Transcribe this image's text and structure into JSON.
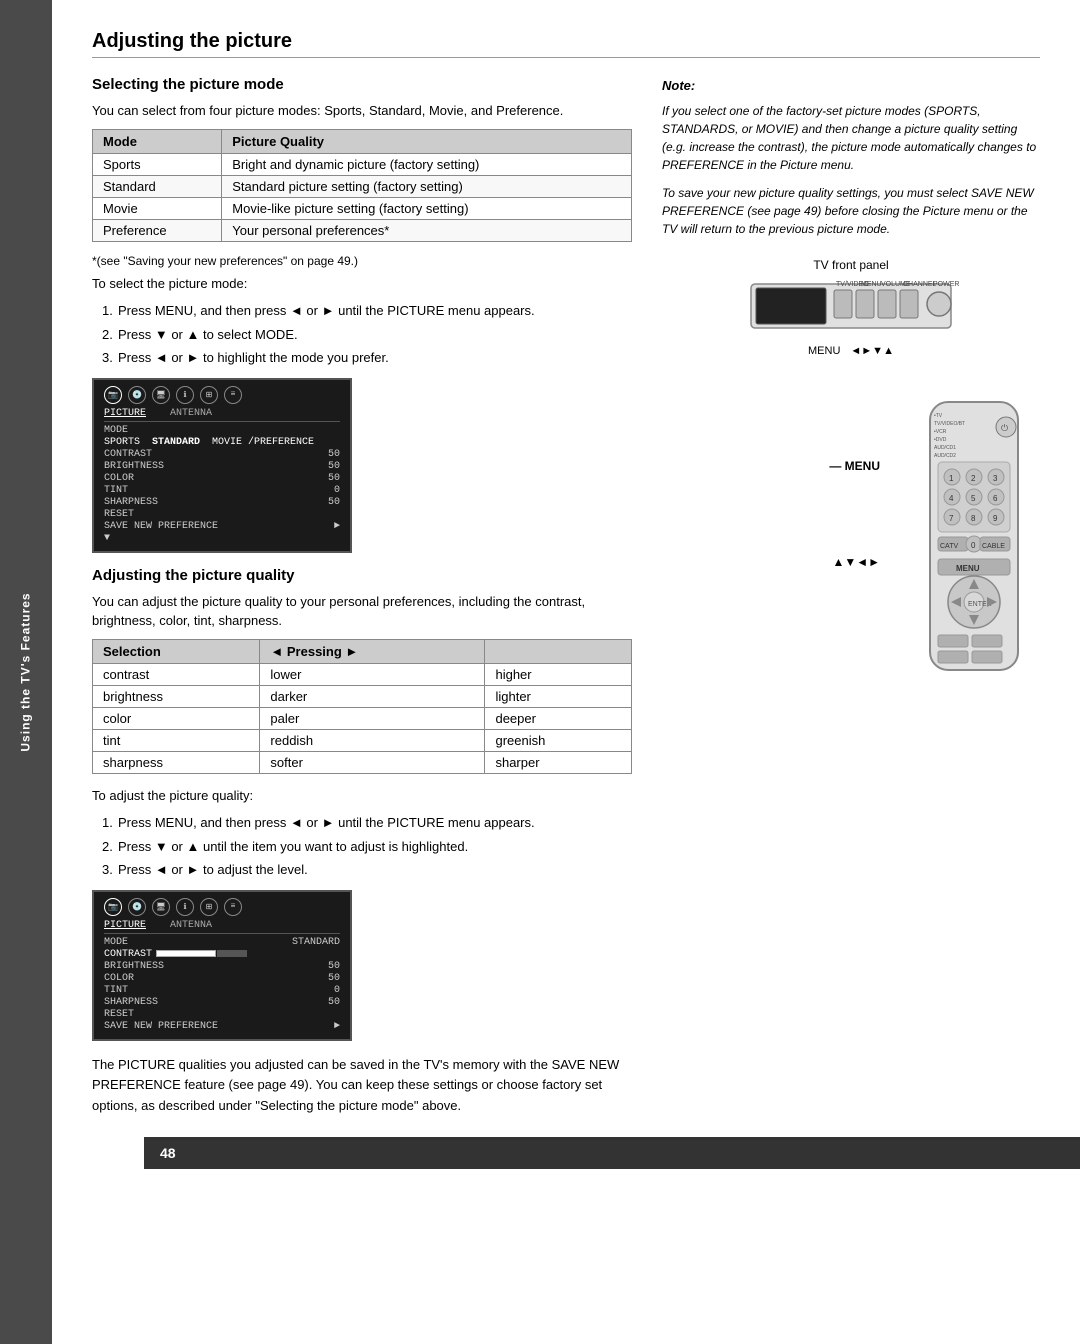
{
  "page": {
    "number": "48",
    "sidebar_text": "Using the TV's Features"
  },
  "main_heading": "Adjusting the picture",
  "selecting_section": {
    "heading": "Selecting the picture mode",
    "intro": "You can select from four picture modes: Sports, Standard, Movie, and Preference.",
    "table": {
      "col1": "Mode",
      "col2": "Picture Quality",
      "rows": [
        {
          "mode": "Sports",
          "quality": "Bright and dynamic picture (factory setting)"
        },
        {
          "mode": "Standard",
          "quality": "Standard picture setting (factory setting)"
        },
        {
          "mode": "Movie",
          "quality": "Movie-like picture setting (factory setting)"
        },
        {
          "mode": "Preference",
          "quality": "Your personal preferences*"
        }
      ]
    },
    "footnote": "*(see \"Saving your new preferences\" on page 49.)",
    "instructions_intro": "To select the picture mode:",
    "steps": [
      "Press MENU, and then press ◄ or ► until the PICTURE menu appears.",
      "Press ▼ or ▲ to select MODE.",
      "Press ◄ or ► to highlight the mode you prefer."
    ]
  },
  "quality_section": {
    "heading": "Adjusting the picture quality",
    "intro": "You can adjust the picture quality to your personal preferences, including the contrast, brightness, color, tint, sharpness.",
    "table": {
      "col1": "Selection",
      "col2": "◄ Pressing ►",
      "rows": [
        {
          "selection": "contrast",
          "left": "lower",
          "right": "higher"
        },
        {
          "selection": "brightness",
          "left": "darker",
          "right": "lighter"
        },
        {
          "selection": "color",
          "left": "paler",
          "right": "deeper"
        },
        {
          "selection": "tint",
          "left": "reddish",
          "right": "greenish"
        },
        {
          "selection": "sharpness",
          "left": "softer",
          "right": "sharper"
        }
      ]
    },
    "instructions_intro": "To adjust the picture quality:",
    "steps": [
      "Press MENU, and then press ◄ or ► until the PICTURE menu appears.",
      "Press ▼ or ▲ until the item you want to adjust is highlighted.",
      "Press ◄ or ► to adjust the level."
    ],
    "bottom_text": "The PICTURE qualities you adjusted can be saved in the TV's memory with the SAVE NEW PREFERENCE feature (see page 49). You can keep these settings or choose factory set options, as described under \"Selecting the picture mode\" above."
  },
  "note_section": {
    "title": "Note:",
    "paragraphs": [
      "If you select one of the factory-set picture modes (SPORTS, STANDARDS, or MOVIE) and then change a picture quality setting (e.g. increase the contrast), the picture mode automatically changes to PREFERENCE in the Picture menu.",
      "To save your new picture quality settings, you must select SAVE NEW PREFERENCE (see page 49) before closing the Picture menu or the TV will return to the previous picture mode."
    ]
  },
  "tv_panel": {
    "label": "TV front panel",
    "buttons": [
      "TV/VIDEO",
      "MENU",
      "VOLUME",
      "CHANNEL",
      "POWER"
    ],
    "menu_label": "MENU",
    "arrows_label": "◄►▼▲"
  },
  "screen1": {
    "icons": [
      "cam",
      "disc",
      "disc2",
      "info",
      "grid",
      "bars"
    ],
    "active_icon": 0,
    "menu_items": [
      "PICTURE",
      "ANTENNA"
    ],
    "active_menu": "PICTURE",
    "mode_line": "MODE",
    "modes": [
      "SPORTS",
      "STANDARD",
      "MOVIE /PREFERENCE"
    ],
    "active_mode": "STANDARD",
    "rows": [
      {
        "label": "CONTRAST",
        "value": "50"
      },
      {
        "label": "BRIGHTNESS",
        "value": "50"
      },
      {
        "label": "COLOR",
        "value": "50"
      },
      {
        "label": "TINT",
        "value": "0"
      },
      {
        "label": "SHARPNESS",
        "value": "50"
      },
      {
        "label": "RESET",
        "value": ""
      },
      {
        "label": "SAVE NEW PREFERENCE",
        "value": "►"
      }
    ]
  },
  "screen2": {
    "menu_items": [
      "PICTURE",
      "ANTENNA"
    ],
    "mode_label": "MODE",
    "mode_value": "STANDARD",
    "rows": [
      {
        "label": "CONTRAST",
        "value": "",
        "has_bar": true
      },
      {
        "label": "BRIGHTNESS",
        "value": "50"
      },
      {
        "label": "COLOR",
        "value": "50"
      },
      {
        "label": "TINT",
        "value": "0"
      },
      {
        "label": "SHARPNESS",
        "value": "50"
      },
      {
        "label": "RESET",
        "value": ""
      },
      {
        "label": "SAVE NEW PREFERENCE",
        "value": "►"
      }
    ]
  },
  "remote": {
    "menu_label": "MENU",
    "arrows_label": "▲▼◄►"
  }
}
